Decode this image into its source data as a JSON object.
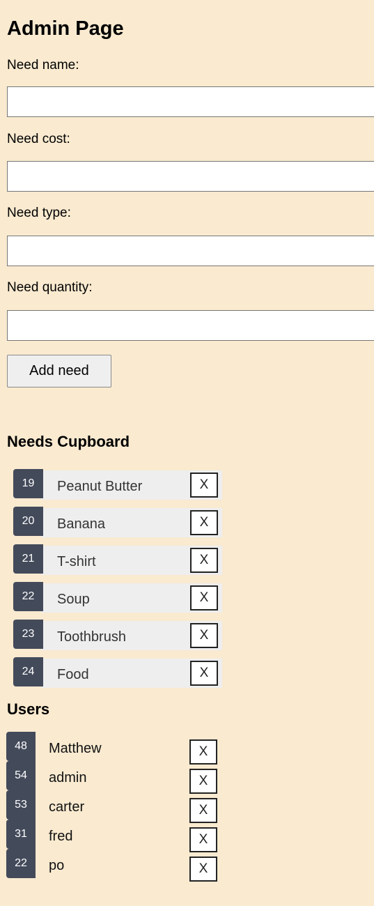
{
  "page": {
    "title": "Admin Page"
  },
  "form": {
    "fields": [
      {
        "label": "Need name:",
        "value": "",
        "placeholder": ""
      },
      {
        "label": "Need cost:",
        "value": "",
        "placeholder": ""
      },
      {
        "label": "Need type:",
        "value": "",
        "placeholder": ""
      },
      {
        "label": "Need quantity:",
        "value": "",
        "placeholder": ""
      }
    ],
    "submit_label": "Add need"
  },
  "cupboard": {
    "heading": "Needs Cupboard",
    "items": [
      {
        "id": "19",
        "name": "Peanut Butter",
        "delete_label": "X"
      },
      {
        "id": "20",
        "name": "Banana",
        "delete_label": "X"
      },
      {
        "id": "21",
        "name": "T-shirt",
        "delete_label": "X"
      },
      {
        "id": "22",
        "name": "Soup",
        "delete_label": "X"
      },
      {
        "id": "23",
        "name": "Toothbrush",
        "delete_label": "X"
      },
      {
        "id": "24",
        "name": "Food",
        "delete_label": "X"
      }
    ]
  },
  "users": {
    "heading": "Users",
    "items": [
      {
        "id": "48",
        "name": "Matthew",
        "delete_label": "X"
      },
      {
        "id": "54",
        "name": "admin",
        "delete_label": "X"
      },
      {
        "id": "53",
        "name": "carter",
        "delete_label": "X"
      },
      {
        "id": "31",
        "name": "fred",
        "delete_label": "X"
      },
      {
        "id": "22",
        "name": "po",
        "delete_label": "X"
      }
    ]
  },
  "colors": {
    "background": "#f9ead0",
    "badge": "#434a5a",
    "item_background": "#eeeeee"
  }
}
